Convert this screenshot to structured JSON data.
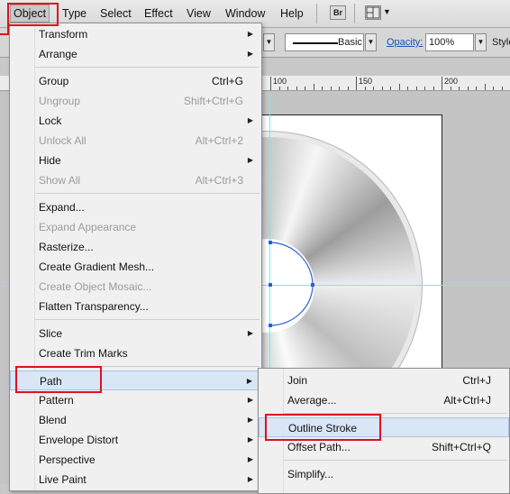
{
  "menubar": {
    "items": [
      "Object",
      "Type",
      "Select",
      "Effect",
      "View",
      "Window",
      "Help"
    ],
    "bridge_label": "Br",
    "arrange_icon": "grid-layout-icon"
  },
  "controlbar": {
    "stroke_style": "Basic",
    "opacity_label": "Opacity:",
    "opacity_value": "100%",
    "style_label": "Style"
  },
  "ruler": {
    "labels": [
      "100",
      "150",
      "200"
    ]
  },
  "object_menu": {
    "items": [
      {
        "label": "Transform",
        "submenu": true
      },
      {
        "label": "Arrange",
        "submenu": true
      },
      {
        "label": "Group",
        "shortcut": "Ctrl+G"
      },
      {
        "label": "Ungroup",
        "shortcut": "Shift+Ctrl+G",
        "disabled": true
      },
      {
        "label": "Lock",
        "submenu": true
      },
      {
        "label": "Unlock All",
        "shortcut": "Alt+Ctrl+2",
        "disabled": true
      },
      {
        "label": "Hide",
        "submenu": true
      },
      {
        "label": "Show All",
        "shortcut": "Alt+Ctrl+3",
        "disabled": true
      },
      {
        "label": "Expand..."
      },
      {
        "label": "Expand Appearance",
        "disabled": true
      },
      {
        "label": "Rasterize..."
      },
      {
        "label": "Create Gradient Mesh..."
      },
      {
        "label": "Create Object Mosaic...",
        "disabled": true
      },
      {
        "label": "Flatten Transparency..."
      },
      {
        "label": "Slice",
        "submenu": true
      },
      {
        "label": "Create Trim Marks"
      },
      {
        "label": "Path",
        "submenu": true,
        "highlighted": true
      },
      {
        "label": "Pattern",
        "submenu": true
      },
      {
        "label": "Blend",
        "submenu": true
      },
      {
        "label": "Envelope Distort",
        "submenu": true
      },
      {
        "label": "Perspective",
        "submenu": true
      },
      {
        "label": "Live Paint",
        "submenu": true
      }
    ]
  },
  "path_submenu": {
    "items": [
      {
        "label": "Join",
        "shortcut": "Ctrl+J"
      },
      {
        "label": "Average...",
        "shortcut": "Alt+Ctrl+J"
      },
      {
        "label": "Outline Stroke",
        "highlighted": true
      },
      {
        "label": "Offset Path...",
        "shortcut": "Shift+Ctrl+Q"
      },
      {
        "label": "Simplify..."
      }
    ]
  },
  "colors": {
    "highlight_box": "#e0101e",
    "menu_highlight": "#d9e6f5",
    "guide": "#6ef0ec",
    "selection": "#2b5fd1"
  }
}
